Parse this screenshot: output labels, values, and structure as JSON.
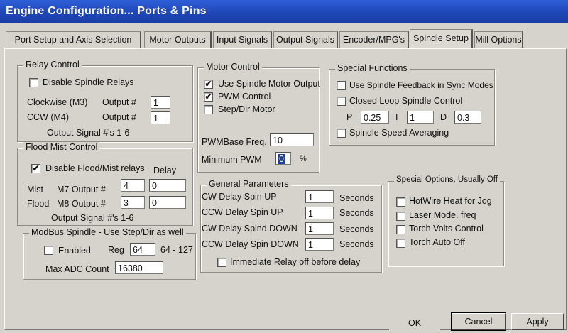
{
  "window": {
    "title": "Engine Configuration... Ports & Pins"
  },
  "tabs": [
    {
      "label": "Port Setup and Axis Selection"
    },
    {
      "label": "Motor Outputs"
    },
    {
      "label": "Input Signals"
    },
    {
      "label": "Output Signals"
    },
    {
      "label": "Encoder/MPG's"
    },
    {
      "label": "Spindle Setup"
    },
    {
      "label": "Mill Options"
    }
  ],
  "relay_control": {
    "title": "Relay Control",
    "disable_label": "Disable Spindle Relays",
    "disable_checked": false,
    "cw_label": "Clockwise (M3)",
    "cw_output_label": "Output #",
    "cw_output": "1",
    "ccw_label": "CCW (M4)",
    "ccw_output_label": "Output #",
    "ccw_output": "1",
    "signal_note": "Output Signal #'s 1-6"
  },
  "flood_mist": {
    "title": "Flood Mist Control",
    "disable_label": "Disable Flood/Mist relays",
    "disable_checked": true,
    "delay_label": "Delay",
    "mist_label": "Mist",
    "mist_output_label": "M7 Output #",
    "mist_output": "4",
    "mist_delay": "0",
    "flood_label": "Flood",
    "flood_output_label": "M8 Output #",
    "flood_output": "3",
    "flood_delay": "0",
    "signal_note": "Output Signal #'s 1-6"
  },
  "modbus": {
    "title": "ModBus Spindle - Use Step/Dir as well",
    "enabled_label": "Enabled",
    "enabled_checked": false,
    "reg_label": "Reg",
    "reg_value": "64",
    "reg_range": "64 - 127",
    "max_adc_label": "Max ADC Count",
    "max_adc_value": "16380"
  },
  "motor_control": {
    "title": "Motor Control",
    "use_spindle_label": "Use Spindle Motor Output",
    "use_spindle_checked": true,
    "pwm_label": "PWM Control",
    "pwm_checked": true,
    "stepdir_label": "Step/Dir Motor",
    "stepdir_checked": false,
    "pwm_base_label": "PWMBase Freq.",
    "pwm_base_value": "10",
    "min_pwm_label": "Minimum PWM",
    "min_pwm_value": "0",
    "min_pwm_unit": "%"
  },
  "general_params": {
    "title": "General Parameters",
    "rows": [
      {
        "label": "CW Delay Spin UP",
        "value": "1",
        "unit": "Seconds"
      },
      {
        "label": "CCW Delay Spin UP",
        "value": "1",
        "unit": "Seconds"
      },
      {
        "label": "CW Delay Spind DOWN",
        "value": "1",
        "unit": "Seconds"
      },
      {
        "label": "CCW Delay Spin DOWN",
        "value": "1",
        "unit": "Seconds"
      }
    ],
    "immediate_label": "Immediate Relay off before delay",
    "immediate_checked": false
  },
  "special_functions": {
    "title": "Special Functions",
    "feedback_label": "Use Spindle Feedback in Sync Modes",
    "feedback_checked": false,
    "closed_loop_label": "Closed Loop Spindle Control",
    "closed_loop_checked": false,
    "p_label": "P",
    "p_value": "0.25",
    "i_label": "I",
    "i_value": "1",
    "d_label": "D",
    "d_value": "0.3",
    "averaging_label": "Spindle Speed Averaging",
    "averaging_checked": false
  },
  "special_options": {
    "title": "Special Options, Usually Off",
    "items": [
      {
        "label": "HotWire Heat for Jog",
        "checked": false
      },
      {
        "label": "Laser Mode. freq",
        "checked": false
      },
      {
        "label": "Torch Volts Control",
        "checked": false
      },
      {
        "label": "Torch Auto Off",
        "checked": false
      }
    ]
  },
  "buttons": {
    "ok": "OK",
    "cancel": "Cancel",
    "apply": "Apply"
  },
  "check_glyph": "✔"
}
